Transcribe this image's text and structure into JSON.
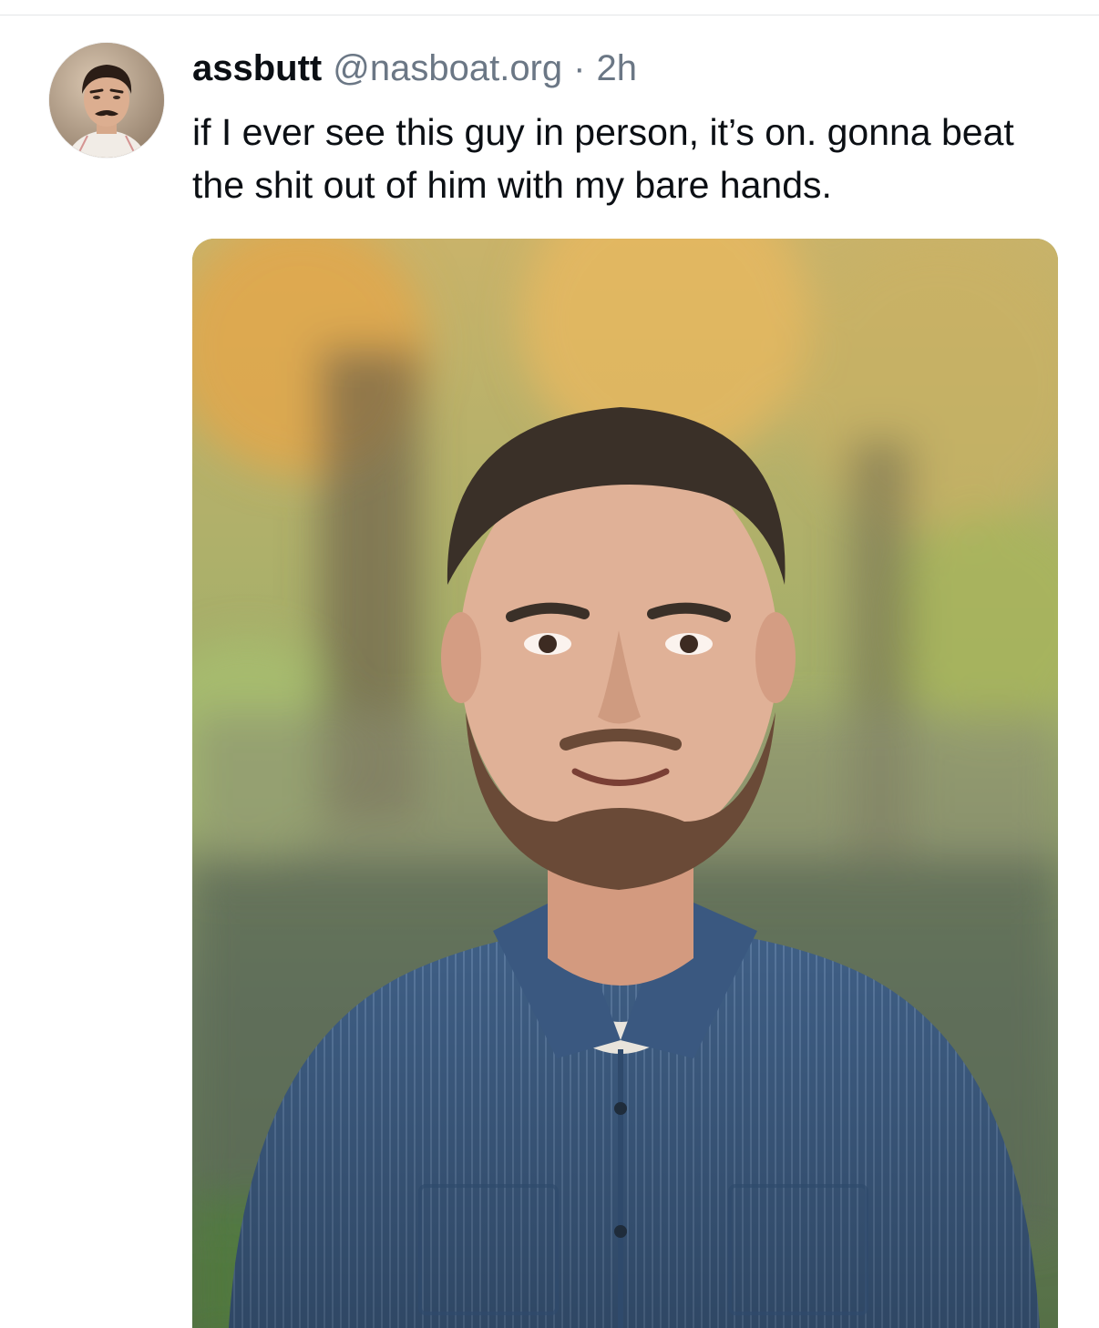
{
  "post": {
    "author": {
      "display_name": "assbutt",
      "handle": "@nasboat.org"
    },
    "separator": "·",
    "timestamp": "2h",
    "text": "if I ever see this guy in person, it’s on. gonna beat the shit out of him with my bare hands."
  },
  "colors": {
    "primary_text": "#0b0f14",
    "secondary_text": "#6b7785",
    "divider": "#e3e5e8"
  }
}
